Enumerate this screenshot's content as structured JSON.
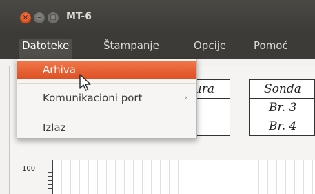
{
  "window": {
    "title": "MT-6",
    "buttons": {
      "close": "×",
      "minimize": "–",
      "maximize": "□"
    }
  },
  "menubar": {
    "items": [
      "Datoteke",
      "Štampanje",
      "Opcije",
      "Pomoć"
    ]
  },
  "dropdown": {
    "items": [
      {
        "label": "Arhiva",
        "highlighted": true
      },
      {
        "label": "Komunikacioni port",
        "has_submenu": true,
        "submenu_arrow": "›"
      },
      {
        "label": "Izlaz"
      }
    ]
  },
  "table": {
    "header_partial": "ura",
    "sonda_header": "Sonda",
    "rows": [
      "Br. 3",
      "Br. 4"
    ]
  },
  "chart": {
    "y_tick_top": "100"
  },
  "colors": {
    "accent": "#dd4814",
    "menubar_bg": "#3c3b37",
    "menu_text": "#dfdbd2"
  }
}
